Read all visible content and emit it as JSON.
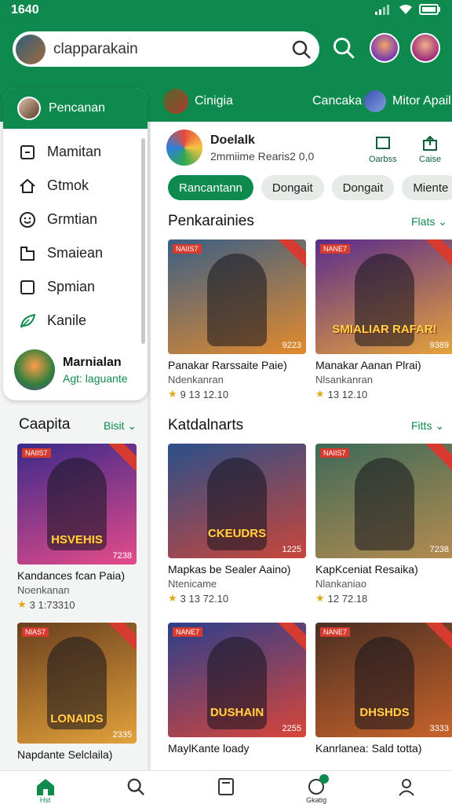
{
  "status": {
    "time": "1640"
  },
  "search": {
    "query": "clapparakain"
  },
  "sidebar": {
    "header_label": "Pencanan",
    "items": [
      {
        "label": "Mamitan",
        "icon": "square-minus-icon"
      },
      {
        "label": "Gtmok",
        "icon": "home-icon"
      },
      {
        "label": "Grmtian",
        "icon": "smiley-icon"
      },
      {
        "label": "Smaiean",
        "icon": "folder-icon"
      },
      {
        "label": "Spmian",
        "icon": "square-icon"
      },
      {
        "label": "Kanile",
        "icon": "leaf-icon"
      }
    ],
    "user": {
      "name": "Marnialan",
      "sub": "Agt: laguante"
    }
  },
  "channels": [
    {
      "label": "Cinigia"
    },
    {
      "label": "Cancaka"
    },
    {
      "label": "Mitor Apail"
    }
  ],
  "publisher": {
    "name": "Doelalk",
    "sub": "2mmiime Rearis2 0,0",
    "action1": "Oarbss",
    "action2": "Caise"
  },
  "chips": [
    "Rancantann",
    "Dongait",
    "Dongait",
    "Miente"
  ],
  "section1": {
    "title": "Penkarainies",
    "link": "Flats",
    "cards": [
      {
        "title": "Panakar Rarssaite Paie)",
        "dev": "Ndenkanran",
        "rating": "9 13 12.10",
        "badge": "NAIIS7",
        "count": "9223",
        "logo": "",
        "bg": [
          "#3b5f86",
          "#e38a2c"
        ]
      },
      {
        "title": "Manakar Aanan Plrai)",
        "dev": "Nlsankanran",
        "rating": "13 12.10",
        "badge": "NANE7",
        "count": "9389",
        "logo": "SMIALIAR RAFAR!",
        "bg": [
          "#5a2c8c",
          "#e6a23a"
        ]
      }
    ]
  },
  "section2": {
    "title": "Katdalnarts",
    "link": "Fitts",
    "cards": [
      {
        "title": "Mapkas be Sealer Aaino)",
        "dev": "Ntenicame",
        "rating": "3 13 72.10",
        "badge": "",
        "count": "1225",
        "logo": "CKEUDRS",
        "bg": [
          "#2b4f8a",
          "#c8463a"
        ]
      },
      {
        "title": "KapKceniat Resaika)",
        "dev": "Nlankaniao",
        "rating": "12 72.18",
        "badge": "NAIIS7",
        "count": "7238",
        "logo": "",
        "bg": [
          "#3d6a58",
          "#b58b4f"
        ]
      },
      {
        "title": "MaylKante loady",
        "dev": "",
        "rating": "",
        "badge": "NANE7",
        "count": "2255",
        "logo": "DUSHAIN",
        "bg": [
          "#2c3f8c",
          "#d8453a"
        ]
      },
      {
        "title": "Kanrlanea: Sald totta)",
        "dev": "",
        "rating": "",
        "badge": "NANE7",
        "count": "3333",
        "logo": "DHSHDS",
        "bg": [
          "#4a2f24",
          "#c8632a"
        ]
      }
    ]
  },
  "left_section": {
    "title": "Caapita",
    "link": "Bisit",
    "cards": [
      {
        "title": "Kandances fcan Paia)",
        "dev": "Noenkanan",
        "rating": "3 1:73310",
        "badge": "NAIIS7",
        "count": "7238",
        "logo": "HSVEHIS",
        "bg": [
          "#3a2a8a",
          "#e64b8a"
        ]
      },
      {
        "title": "Napdante Selclaila)",
        "dev": "",
        "rating": "",
        "badge": "NIAS7",
        "count": "2335",
        "logo": "LONAIDS",
        "bg": [
          "#6a3f1e",
          "#e3a23a"
        ]
      }
    ]
  },
  "bottom_nav": {
    "home_label": "Hst",
    "chat_label": "Gkatig"
  },
  "colors": {
    "brand": "#0f8a4f",
    "star": "#e2a71b",
    "badge": "#d63b2f"
  }
}
